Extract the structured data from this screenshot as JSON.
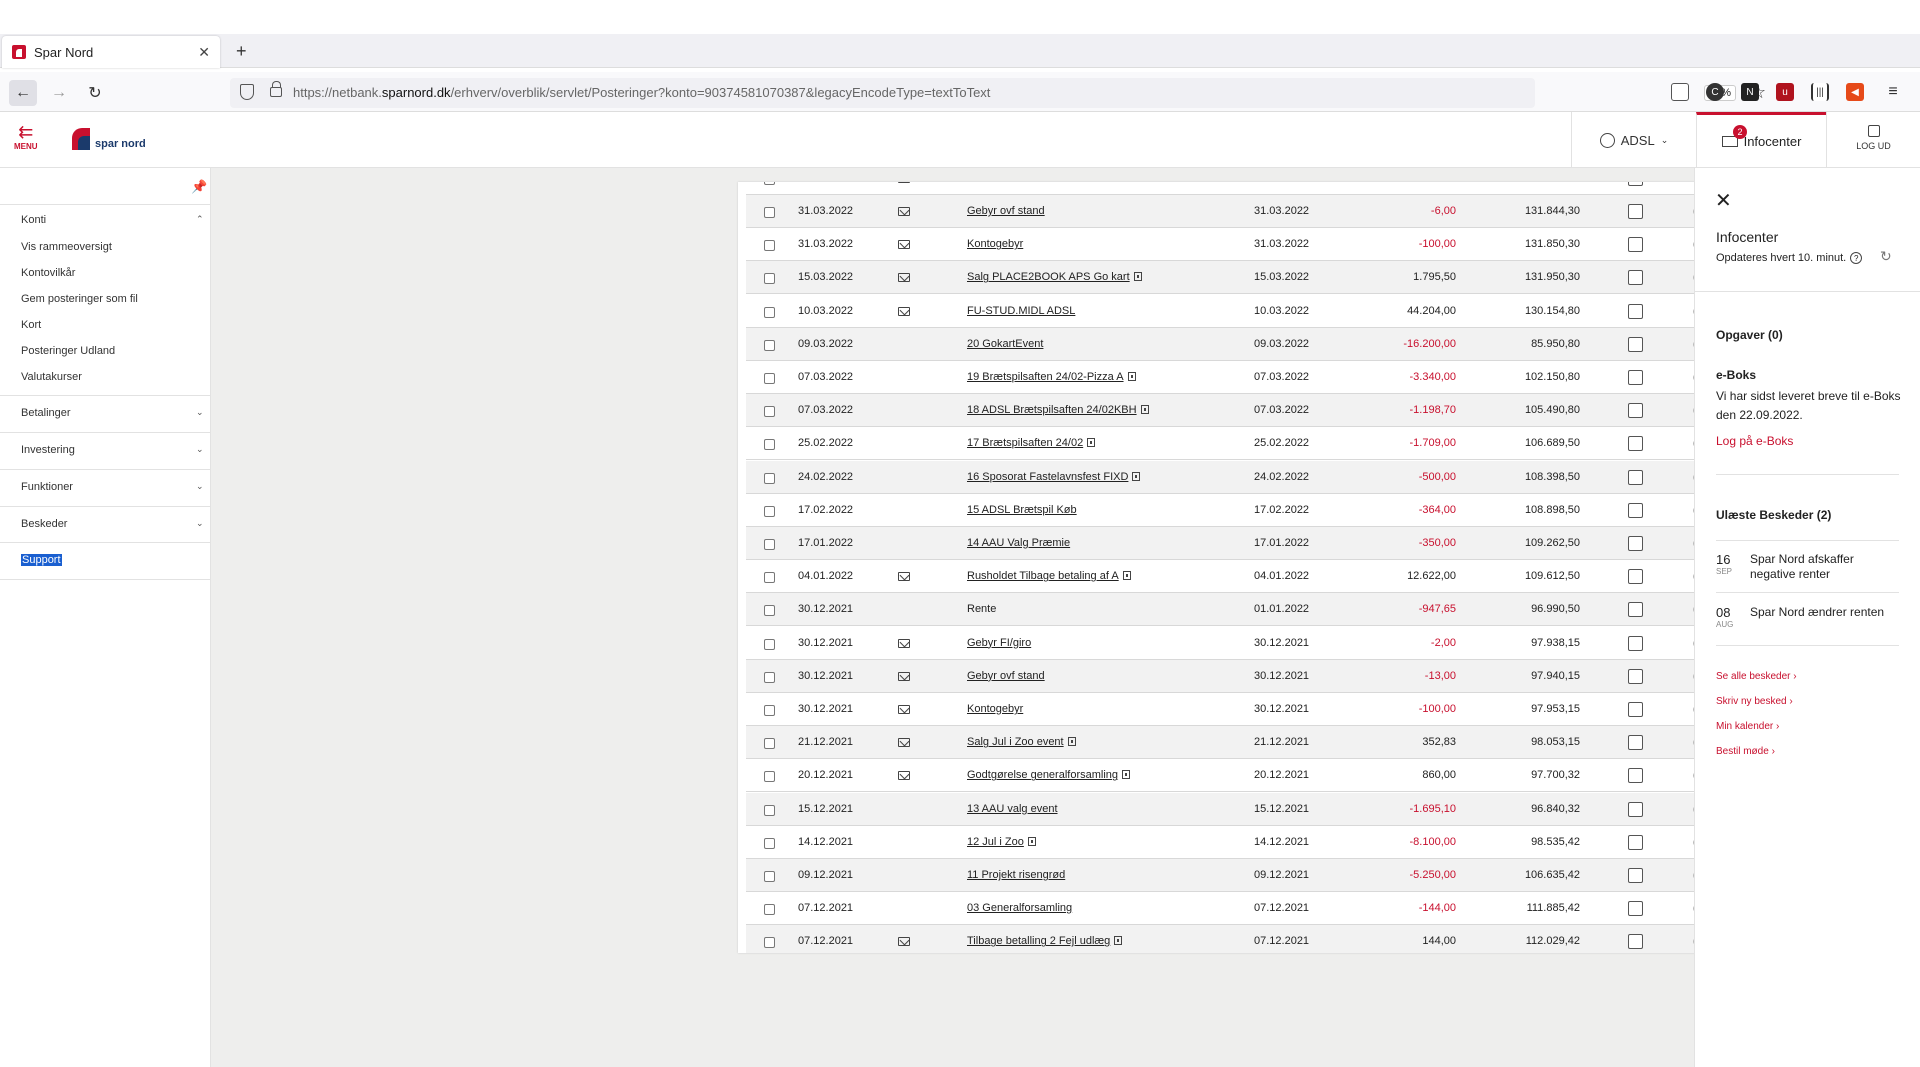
{
  "browser": {
    "tab_title": "Spar Nord",
    "url_prefix": "https://netbank.",
    "url_domain": "sparnord.dk",
    "url_rest": "/erhverv/overblik/servlet/Posteringer?konto=90374581070387&legacyEncodeType=textToText",
    "zoom": "90%"
  },
  "header": {
    "menu_label": "MENU",
    "logo_text": "spar nord",
    "user_label": "ADSL",
    "infocenter_label": "Infocenter",
    "infocenter_badge": "2",
    "logout_label": "LOG UD"
  },
  "sidebar": {
    "konti_label": "Konti",
    "konti_items": [
      "Vis rammeoversigt",
      "Kontovilkår",
      "Gem posteringer som fil",
      "Kort",
      "Posteringer Udland",
      "Valutakurser"
    ],
    "sections": [
      "Betalinger",
      "Investering",
      "Funktioner",
      "Beskeder"
    ],
    "support_label": "Support"
  },
  "transactions": [
    {
      "date": "31.03.2022",
      "env": true,
      "text": "Gebyr ovf stand",
      "info": false,
      "link": true,
      "val_date": "31.03.2022",
      "amount": "-6,00",
      "neg": true,
      "balance": "131.844,30"
    },
    {
      "date": "31.03.2022",
      "env": true,
      "text": "Kontogebyr",
      "info": false,
      "link": true,
      "val_date": "31.03.2022",
      "amount": "-100,00",
      "neg": true,
      "balance": "131.850,30"
    },
    {
      "date": "15.03.2022",
      "env": true,
      "text": "Salg PLACE2BOOK APS Go kart",
      "info": true,
      "link": true,
      "val_date": "15.03.2022",
      "amount": "1.795,50",
      "neg": false,
      "balance": "131.950,30"
    },
    {
      "date": "10.03.2022",
      "env": true,
      "text": "FU-STUD.MIDL ADSL",
      "info": false,
      "link": true,
      "val_date": "10.03.2022",
      "amount": "44.204,00",
      "neg": false,
      "balance": "130.154,80"
    },
    {
      "date": "09.03.2022",
      "env": false,
      "text": "20 GokartEvent",
      "info": false,
      "link": true,
      "val_date": "09.03.2022",
      "amount": "-16.200,00",
      "neg": true,
      "balance": "85.950,80"
    },
    {
      "date": "07.03.2022",
      "env": false,
      "text": "19 Brætspilsaften 24/02-Pizza A",
      "info": true,
      "link": true,
      "val_date": "07.03.2022",
      "amount": "-3.340,00",
      "neg": true,
      "balance": "102.150,80"
    },
    {
      "date": "07.03.2022",
      "env": false,
      "text": "18 ADSL Brætspilsaften 24/02KBH",
      "info": true,
      "link": true,
      "val_date": "07.03.2022",
      "amount": "-1.198,70",
      "neg": true,
      "balance": "105.490,80"
    },
    {
      "date": "25.02.2022",
      "env": false,
      "text": "17 Brætspilsaften 24/02",
      "info": true,
      "link": true,
      "val_date": "25.02.2022",
      "amount": "-1.709,00",
      "neg": true,
      "balance": "106.689,50"
    },
    {
      "date": "24.02.2022",
      "env": false,
      "text": "16 Sposorat Fastelavnsfest FIXD",
      "info": true,
      "link": true,
      "val_date": "24.02.2022",
      "amount": "-500,00",
      "neg": true,
      "balance": "108.398,50"
    },
    {
      "date": "17.02.2022",
      "env": false,
      "text": "15 ADSL Brætspil Køb",
      "info": false,
      "link": true,
      "val_date": "17.02.2022",
      "amount": "-364,00",
      "neg": true,
      "balance": "108.898,50"
    },
    {
      "date": "17.01.2022",
      "env": false,
      "text": "14 AAU Valg Præmie",
      "info": false,
      "link": true,
      "val_date": "17.01.2022",
      "amount": "-350,00",
      "neg": true,
      "balance": "109.262,50"
    },
    {
      "date": "04.01.2022",
      "env": true,
      "text": "Rusholdet Tilbage betaling af A",
      "info": true,
      "link": true,
      "val_date": "04.01.2022",
      "amount": "12.622,00",
      "neg": false,
      "balance": "109.612,50"
    },
    {
      "date": "30.12.2021",
      "env": false,
      "text": "Rente",
      "info": false,
      "link": false,
      "val_date": "01.01.2022",
      "amount": "-947,65",
      "neg": true,
      "balance": "96.990,50"
    },
    {
      "date": "30.12.2021",
      "env": true,
      "text": "Gebyr FI/giro",
      "info": false,
      "link": true,
      "val_date": "30.12.2021",
      "amount": "-2,00",
      "neg": true,
      "balance": "97.938,15"
    },
    {
      "date": "30.12.2021",
      "env": true,
      "text": "Gebyr ovf stand",
      "info": false,
      "link": true,
      "val_date": "30.12.2021",
      "amount": "-13,00",
      "neg": true,
      "balance": "97.940,15"
    },
    {
      "date": "30.12.2021",
      "env": true,
      "text": "Kontogebyr",
      "info": false,
      "link": true,
      "val_date": "30.12.2021",
      "amount": "-100,00",
      "neg": true,
      "balance": "97.953,15"
    },
    {
      "date": "21.12.2021",
      "env": true,
      "text": "Salg Jul i Zoo event",
      "info": true,
      "link": true,
      "val_date": "21.12.2021",
      "amount": "352,83",
      "neg": false,
      "balance": "98.053,15"
    },
    {
      "date": "20.12.2021",
      "env": true,
      "text": "Godtgørelse generalforsamling",
      "info": true,
      "link": true,
      "val_date": "20.12.2021",
      "amount": "860,00",
      "neg": false,
      "balance": "97.700,32"
    },
    {
      "date": "15.12.2021",
      "env": false,
      "text": "13 AAU valg event",
      "info": false,
      "link": true,
      "val_date": "15.12.2021",
      "amount": "-1.695,10",
      "neg": true,
      "balance": "96.840,32"
    },
    {
      "date": "14.12.2021",
      "env": false,
      "text": "12 Jul i Zoo",
      "info": true,
      "link": true,
      "val_date": "14.12.2021",
      "amount": "-8.100,00",
      "neg": true,
      "balance": "98.535,42"
    },
    {
      "date": "09.12.2021",
      "env": false,
      "text": "11 Projekt risengrød",
      "info": false,
      "link": true,
      "val_date": "09.12.2021",
      "amount": "-5.250,00",
      "neg": true,
      "balance": "106.635,42"
    },
    {
      "date": "07.12.2021",
      "env": false,
      "text": "03 Generalforsamling",
      "info": false,
      "link": true,
      "val_date": "07.12.2021",
      "amount": "-144,00",
      "neg": true,
      "balance": "111.885,42"
    },
    {
      "date": "07.12.2021",
      "env": true,
      "text": "Tilbage betalling 2 Fejl udlæg",
      "info": true,
      "link": true,
      "val_date": "07.12.2021",
      "amount": "144,00",
      "neg": false,
      "balance": "112.029,42"
    }
  ],
  "infocenter": {
    "title": "Infocenter",
    "subtitle": "Opdateres hvert 10. minut.",
    "tasks_heading": "Opgaver (0)",
    "eboks_heading": "e-Boks",
    "eboks_text": "Vi har sidst leveret breve til e-Boks den 22.09.2022.",
    "eboks_link": "Log på e-Boks",
    "messages_heading": "Ulæste Beskeder (2)",
    "messages": [
      {
        "day": "16",
        "month": "SEP",
        "title": "Spar Nord afskaffer negative renter"
      },
      {
        "day": "08",
        "month": "AUG",
        "title": "Spar Nord ændrer renten"
      }
    ],
    "links": [
      "Se alle beskeder ›",
      "Skriv ny besked ›",
      "Min kalender ›",
      "Bestil møde ›"
    ]
  }
}
